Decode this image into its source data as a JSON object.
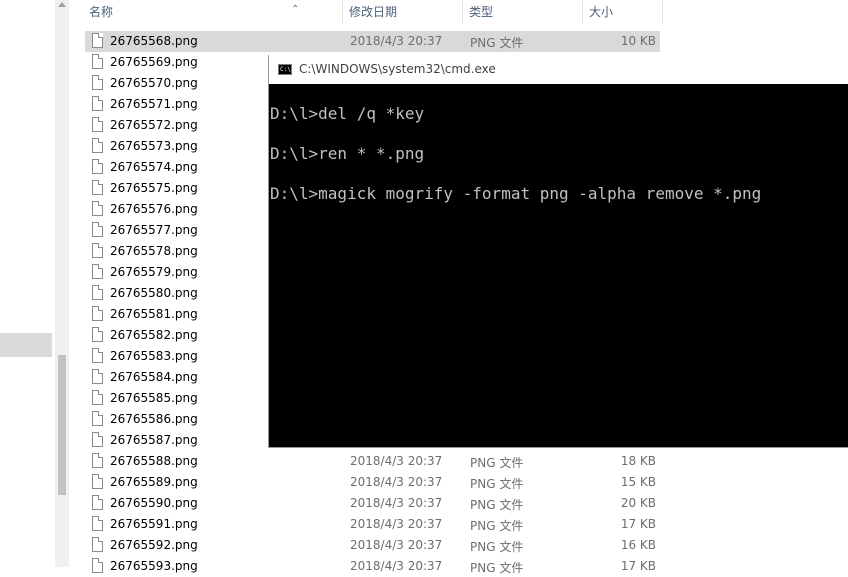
{
  "explorer": {
    "columns": {
      "name": "名称",
      "date": "修改日期",
      "type": "类型",
      "size": "大小"
    },
    "files": [
      {
        "name": "26765568.png",
        "date": "2018/4/3 20:37",
        "type": "PNG 文件",
        "size": "10 KB",
        "selected": true
      },
      {
        "name": "26765569.png",
        "date": "",
        "type": "",
        "size": ""
      },
      {
        "name": "26765570.png",
        "date": "",
        "type": "",
        "size": ""
      },
      {
        "name": "26765571.png",
        "date": "",
        "type": "",
        "size": ""
      },
      {
        "name": "26765572.png",
        "date": "",
        "type": "",
        "size": ""
      },
      {
        "name": "26765573.png",
        "date": "",
        "type": "",
        "size": ""
      },
      {
        "name": "26765574.png",
        "date": "",
        "type": "",
        "size": ""
      },
      {
        "name": "26765575.png",
        "date": "",
        "type": "",
        "size": ""
      },
      {
        "name": "26765576.png",
        "date": "",
        "type": "",
        "size": ""
      },
      {
        "name": "26765577.png",
        "date": "",
        "type": "",
        "size": ""
      },
      {
        "name": "26765578.png",
        "date": "",
        "type": "",
        "size": ""
      },
      {
        "name": "26765579.png",
        "date": "",
        "type": "",
        "size": ""
      },
      {
        "name": "26765580.png",
        "date": "",
        "type": "",
        "size": ""
      },
      {
        "name": "26765581.png",
        "date": "",
        "type": "",
        "size": ""
      },
      {
        "name": "26765582.png",
        "date": "",
        "type": "",
        "size": ""
      },
      {
        "name": "26765583.png",
        "date": "",
        "type": "",
        "size": ""
      },
      {
        "name": "26765584.png",
        "date": "",
        "type": "",
        "size": ""
      },
      {
        "name": "26765585.png",
        "date": "",
        "type": "",
        "size": ""
      },
      {
        "name": "26765586.png",
        "date": "",
        "type": "",
        "size": ""
      },
      {
        "name": "26765587.png",
        "date": "",
        "type": "",
        "size": ""
      },
      {
        "name": "26765588.png",
        "date": "2018/4/3 20:37",
        "type": "PNG 文件",
        "size": "18 KB"
      },
      {
        "name": "26765589.png",
        "date": "2018/4/3 20:37",
        "type": "PNG 文件",
        "size": "15 KB"
      },
      {
        "name": "26765590.png",
        "date": "2018/4/3 20:37",
        "type": "PNG 文件",
        "size": "20 KB"
      },
      {
        "name": "26765591.png",
        "date": "2018/4/3 20:37",
        "type": "PNG 文件",
        "size": "17 KB"
      },
      {
        "name": "26765592.png",
        "date": "2018/4/3 20:37",
        "type": "PNG 文件",
        "size": "16 KB"
      },
      {
        "name": "26765593.png",
        "date": "2018/4/3 20:37",
        "type": "PNG 文件",
        "size": "17 KB"
      }
    ]
  },
  "cmd": {
    "title": "C:\\WINDOWS\\system32\\cmd.exe",
    "icon_text": "C:\\",
    "lines": [
      "D:\\l>del /q *key",
      "D:\\l>ren * *.png",
      "D:\\l>magick mogrify -format png -alpha remove *.png"
    ]
  }
}
